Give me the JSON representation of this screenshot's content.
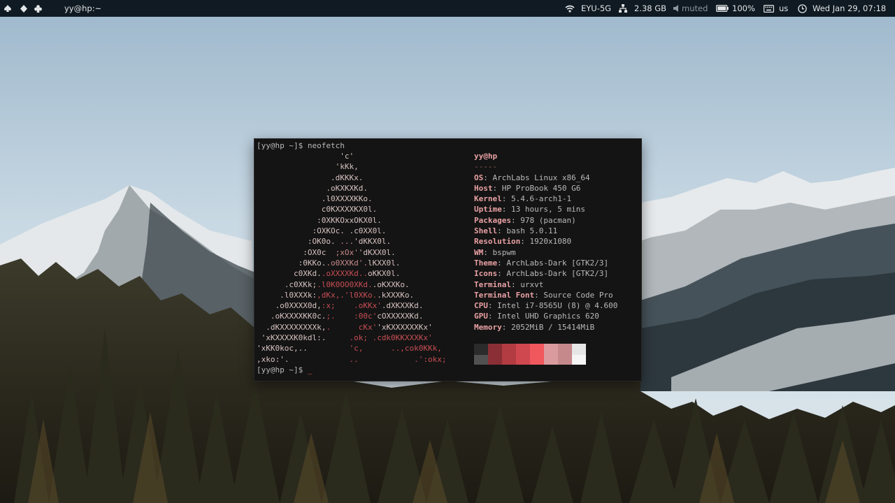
{
  "topbar": {
    "workspaces": [
      "spade-icon",
      "diamond-icon",
      "club-icon"
    ],
    "window_title": "yy@hp:~",
    "wifi": "EYU-5G",
    "memory": "2.38 GB",
    "volume": "muted",
    "battery": "100%",
    "keyboard_layout": "us",
    "clock": "Wed Jan 29, 07:18"
  },
  "terminal": {
    "prompt": "[yy@hp ~]$ ",
    "command": "neofetch",
    "cursor": "_",
    "logo_lines": [
      [
        [
          "a",
          "                  'c'"
        ]
      ],
      [
        [
          "a",
          "                 'kKk,"
        ]
      ],
      [
        [
          "a",
          "                .dKKKx."
        ]
      ],
      [
        [
          "a",
          "               .oKXKXKd."
        ]
      ],
      [
        [
          "a",
          "              .l0XXXXKKo."
        ]
      ],
      [
        [
          "a",
          "              c0KXXXXKX0l."
        ]
      ],
      [
        [
          "a",
          "             :0XKKOxxOKX0l."
        ]
      ],
      [
        [
          "a",
          "            :OXKOc. .c0XX0l."
        ]
      ],
      [
        [
          "a",
          "           :OK0o. "
        ],
        [
          "b",
          "..."
        ],
        [
          "a",
          "'dKKX0l."
        ]
      ],
      [
        [
          "a",
          "          :OX0c  "
        ],
        [
          "b",
          ";xOx'"
        ],
        [
          "a",
          "'dKXX0l."
        ]
      ],
      [
        [
          "a",
          "         :0KKo."
        ],
        [
          "b",
          ".o0XXKd'."
        ],
        [
          "a",
          "lKXX0l."
        ]
      ],
      [
        [
          "a",
          "        c0XKd."
        ],
        [
          "c",
          ".oXXXXKd.."
        ],
        [
          "a",
          "oKKX0l."
        ]
      ],
      [
        [
          "a",
          "      .c0XKk;"
        ],
        [
          "c",
          ".l0K0OO0XKd."
        ],
        [
          "a",
          ".oKXXKo."
        ]
      ],
      [
        [
          "a",
          "     .l0XXXk:"
        ],
        [
          "c",
          ",dKx,.'l0XKo."
        ],
        [
          "a",
          ".kXXXKo."
        ]
      ],
      [
        [
          "a",
          "    .o0XXXX0d,"
        ],
        [
          "c",
          ":x;    .oKKx'"
        ],
        [
          "a",
          ".dXKXXKd."
        ]
      ],
      [
        [
          "a",
          "   .oKXXXXKK0c."
        ],
        [
          "c",
          ";.    :00c'"
        ],
        [
          "a",
          "cOXXXXXKd."
        ]
      ],
      [
        [
          "a",
          "  .dKXXXXXXXXk,"
        ],
        [
          "c",
          ".      cKx'"
        ],
        [
          "a",
          "'xKXXXXXXKx'"
        ]
      ],
      [
        [
          "a",
          " 'xKXXXXK0kdl:."
        ],
        [
          "c",
          "     .ok; .cdk0KKXXXKx'"
        ]
      ],
      [
        [
          "a",
          "'xKK0koc,.."
        ],
        [
          "c",
          "         'c,      ..,cok0KKk,"
        ]
      ],
      [
        [
          "a",
          ",xko:'."
        ],
        [
          "c",
          "             ..            .':okx;"
        ]
      ]
    ],
    "info": {
      "user_host": "yy@hp",
      "separator": "-----",
      "fields": [
        {
          "key": "OS",
          "value": "ArchLabs Linux x86_64"
        },
        {
          "key": "Host",
          "value": "HP ProBook 450 G6"
        },
        {
          "key": "Kernel",
          "value": "5.4.6-arch1-1"
        },
        {
          "key": "Uptime",
          "value": "13 hours, 5 mins"
        },
        {
          "key": "Packages",
          "value": "978 (pacman)"
        },
        {
          "key": "Shell",
          "value": "bash 5.0.11"
        },
        {
          "key": "Resolution",
          "value": "1920x1080"
        },
        {
          "key": "WM",
          "value": "bspwm"
        },
        {
          "key": "Theme",
          "value": "ArchLabs-Dark [GTK2/3]"
        },
        {
          "key": "Icons",
          "value": "ArchLabs-Dark [GTK2/3]"
        },
        {
          "key": "Terminal",
          "value": "urxvt"
        },
        {
          "key": "Terminal Font",
          "value": "Source Code Pro"
        },
        {
          "key": "CPU",
          "value": "Intel i7-8565U (8) @ 4.600"
        },
        {
          "key": "GPU",
          "value": "Intel UHD Graphics 620"
        },
        {
          "key": "Memory",
          "value": "2052MiB / 15414MiB"
        }
      ]
    },
    "palette_top": [
      "#2b2b2b",
      "#8a2f36",
      "#b33b42",
      "#d0484f",
      "#f0585e",
      "#da9b9e",
      "#c5898c",
      "#e6e6e6"
    ],
    "palette_bottom": [
      "#515151",
      "#8a2f36",
      "#b33b42",
      "#d0484f",
      "#f0585e",
      "#da9b9e",
      "#c5898c",
      "#f5f5f5"
    ]
  }
}
